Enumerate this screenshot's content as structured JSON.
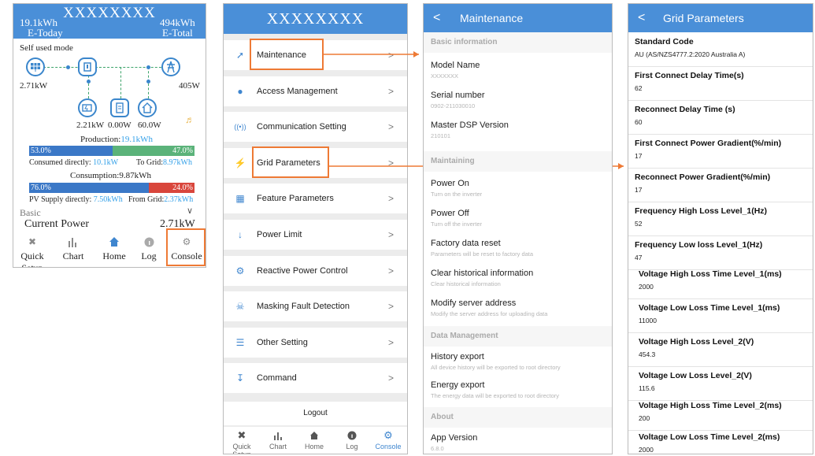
{
  "home": {
    "title": "XXXXXXXX",
    "e_today_value": "19.1kWh",
    "e_today_label": "E-Today",
    "e_total_value": "494kWh",
    "e_total_label": "E-Total",
    "mode": "Self used mode",
    "pv_power": "2.71kW",
    "grid_power": "405W",
    "battery_power": "2.21kW",
    "meter_power": "0.00W",
    "load_power": "60.0W",
    "production_label": "Production:",
    "production_value": "19.1kWh",
    "production_left_pct": "53.0%",
    "production_right_pct": "47.0%",
    "production_left_frac": 0.53,
    "consumed_directly_label": "Consumed directly:",
    "consumed_directly_value": "10.1kW",
    "to_grid_label": "To Grid:",
    "to_grid_value": "8.97kWh",
    "consumption_label": "Consumption:",
    "consumption_value": "9.87kWh",
    "consumption_left_pct": "76.0%",
    "consumption_right_pct": "24.0%",
    "consumption_left_frac": 0.76,
    "pv_supply_label": "PV Supply directly:",
    "pv_supply_value": "7.50kWh",
    "from_grid_label": "From Grid:",
    "from_grid_value": "2.37kWh",
    "basic_label": "Basic",
    "current_power_label": "Current Power",
    "current_power_value": "2.71kW",
    "tabs": [
      "Quick Setup",
      "Chart",
      "Home",
      "Log",
      "Console"
    ]
  },
  "console": {
    "title": "XXXXXXXX",
    "items": [
      {
        "label": "Maintenance",
        "icon": "wrench-icon"
      },
      {
        "label": "Access Management",
        "icon": "user-icon"
      },
      {
        "label": "Communication Setting",
        "icon": "signal-icon"
      },
      {
        "label": "Grid Parameters",
        "icon": "lightning-icon"
      },
      {
        "label": "Feature Parameters",
        "icon": "grid-icon"
      },
      {
        "label": "Power Limit",
        "icon": "arrow-down-icon"
      },
      {
        "label": "Reactive Power Control",
        "icon": "gear-icon"
      },
      {
        "label": "Masking Fault Detection",
        "icon": "bell-off-icon"
      },
      {
        "label": "Other Setting",
        "icon": "menu-icon"
      },
      {
        "label": "Command",
        "icon": "command-icon"
      }
    ],
    "logout": "Logout",
    "tabs": [
      "Quick Setup",
      "Chart",
      "Home",
      "Log",
      "Console"
    ]
  },
  "maintenance": {
    "title": "Maintenance",
    "basic_info": "Basic information",
    "model_name_label": "Model Name",
    "model_name_value": "XXXXXXX",
    "serial_label": "Serial number",
    "serial_value": "0902-211030010",
    "dsp_label": "Master DSP Version",
    "dsp_value": "210101",
    "maintaining": "Maintaining",
    "power_on": "Power On",
    "power_on_sub": "Turn on the inverter",
    "power_off": "Power Off",
    "power_off_sub": "Turn off the inverter",
    "factory_reset": "Factory data reset",
    "factory_reset_sub": "Parameters will be reset to factory data",
    "clear_history": "Clear historical information",
    "clear_history_sub": "Clear historical information",
    "modify_server": "Modify server address",
    "modify_server_sub": "Modify the server address for uploading data",
    "data_mgmt": "Data Management",
    "history_export": "History export",
    "history_export_sub": "All device history will be exported to root directory",
    "energy_export": "Energy export",
    "energy_export_sub": "The energy data will be exported to root directory",
    "about": "About",
    "app_version_label": "App Version",
    "app_version_value": "6.8.0"
  },
  "grid": {
    "title": "Grid Parameters",
    "items": [
      {
        "label": "Standard Code",
        "value": "AU (AS/NZS4777.2:2020 Australia A)"
      },
      {
        "label": "First Connect Delay Time(s)",
        "value": "62"
      },
      {
        "label": "Reconnect Delay Time (s)",
        "value": "60"
      },
      {
        "label": "First Connect Power Gradient(%/min)",
        "value": "17"
      },
      {
        "label": "Reconnect Power Gradient(%/min)",
        "value": "17"
      },
      {
        "label": "Frequency High Loss Level_1(Hz)",
        "value": "52"
      },
      {
        "label": "Frequency Low loss Level_1(Hz)",
        "value": "47"
      },
      {
        "label": "Voltage High Loss Time Level_1(ms)",
        "value": "2000"
      },
      {
        "label": "Voltage Low Loss Time Level_1(ms)",
        "value": "11000"
      },
      {
        "label": "Voltage High Loss Level_2(V)",
        "value": "454.3"
      },
      {
        "label": "Voltage Low Loss Level_2(V)",
        "value": "115.6"
      },
      {
        "label": "Voltage High Loss Time Level_2(ms)",
        "value": "200"
      },
      {
        "label": "Voltage Low Loss Time Level_2(ms)",
        "value": "2000"
      }
    ]
  },
  "colors": {
    "header_blue": "#4a8fd8",
    "highlight_orange": "#ee7a35",
    "production_blue": "#3b78c7",
    "production_green": "#5bb37a",
    "consumption_red": "#d9463c",
    "link_blue": "#33a0e8"
  }
}
